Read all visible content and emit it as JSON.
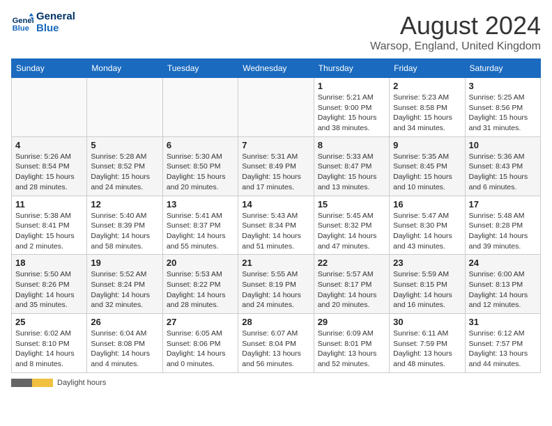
{
  "header": {
    "logo_line1": "General",
    "logo_line2": "Blue",
    "month_year": "August 2024",
    "location": "Warsop, England, United Kingdom"
  },
  "days_of_week": [
    "Sunday",
    "Monday",
    "Tuesday",
    "Wednesday",
    "Thursday",
    "Friday",
    "Saturday"
  ],
  "weeks": [
    [
      {
        "day": "",
        "info": ""
      },
      {
        "day": "",
        "info": ""
      },
      {
        "day": "",
        "info": ""
      },
      {
        "day": "",
        "info": ""
      },
      {
        "day": "1",
        "info": "Sunrise: 5:21 AM\nSunset: 9:00 PM\nDaylight: 15 hours\nand 38 minutes."
      },
      {
        "day": "2",
        "info": "Sunrise: 5:23 AM\nSunset: 8:58 PM\nDaylight: 15 hours\nand 34 minutes."
      },
      {
        "day": "3",
        "info": "Sunrise: 5:25 AM\nSunset: 8:56 PM\nDaylight: 15 hours\nand 31 minutes."
      }
    ],
    [
      {
        "day": "4",
        "info": "Sunrise: 5:26 AM\nSunset: 8:54 PM\nDaylight: 15 hours\nand 28 minutes."
      },
      {
        "day": "5",
        "info": "Sunrise: 5:28 AM\nSunset: 8:52 PM\nDaylight: 15 hours\nand 24 minutes."
      },
      {
        "day": "6",
        "info": "Sunrise: 5:30 AM\nSunset: 8:50 PM\nDaylight: 15 hours\nand 20 minutes."
      },
      {
        "day": "7",
        "info": "Sunrise: 5:31 AM\nSunset: 8:49 PM\nDaylight: 15 hours\nand 17 minutes."
      },
      {
        "day": "8",
        "info": "Sunrise: 5:33 AM\nSunset: 8:47 PM\nDaylight: 15 hours\nand 13 minutes."
      },
      {
        "day": "9",
        "info": "Sunrise: 5:35 AM\nSunset: 8:45 PM\nDaylight: 15 hours\nand 10 minutes."
      },
      {
        "day": "10",
        "info": "Sunrise: 5:36 AM\nSunset: 8:43 PM\nDaylight: 15 hours\nand 6 minutes."
      }
    ],
    [
      {
        "day": "11",
        "info": "Sunrise: 5:38 AM\nSunset: 8:41 PM\nDaylight: 15 hours\nand 2 minutes."
      },
      {
        "day": "12",
        "info": "Sunrise: 5:40 AM\nSunset: 8:39 PM\nDaylight: 14 hours\nand 58 minutes."
      },
      {
        "day": "13",
        "info": "Sunrise: 5:41 AM\nSunset: 8:37 PM\nDaylight: 14 hours\nand 55 minutes."
      },
      {
        "day": "14",
        "info": "Sunrise: 5:43 AM\nSunset: 8:34 PM\nDaylight: 14 hours\nand 51 minutes."
      },
      {
        "day": "15",
        "info": "Sunrise: 5:45 AM\nSunset: 8:32 PM\nDaylight: 14 hours\nand 47 minutes."
      },
      {
        "day": "16",
        "info": "Sunrise: 5:47 AM\nSunset: 8:30 PM\nDaylight: 14 hours\nand 43 minutes."
      },
      {
        "day": "17",
        "info": "Sunrise: 5:48 AM\nSunset: 8:28 PM\nDaylight: 14 hours\nand 39 minutes."
      }
    ],
    [
      {
        "day": "18",
        "info": "Sunrise: 5:50 AM\nSunset: 8:26 PM\nDaylight: 14 hours\nand 35 minutes."
      },
      {
        "day": "19",
        "info": "Sunrise: 5:52 AM\nSunset: 8:24 PM\nDaylight: 14 hours\nand 32 minutes."
      },
      {
        "day": "20",
        "info": "Sunrise: 5:53 AM\nSunset: 8:22 PM\nDaylight: 14 hours\nand 28 minutes."
      },
      {
        "day": "21",
        "info": "Sunrise: 5:55 AM\nSunset: 8:19 PM\nDaylight: 14 hours\nand 24 minutes."
      },
      {
        "day": "22",
        "info": "Sunrise: 5:57 AM\nSunset: 8:17 PM\nDaylight: 14 hours\nand 20 minutes."
      },
      {
        "day": "23",
        "info": "Sunrise: 5:59 AM\nSunset: 8:15 PM\nDaylight: 14 hours\nand 16 minutes."
      },
      {
        "day": "24",
        "info": "Sunrise: 6:00 AM\nSunset: 8:13 PM\nDaylight: 14 hours\nand 12 minutes."
      }
    ],
    [
      {
        "day": "25",
        "info": "Sunrise: 6:02 AM\nSunset: 8:10 PM\nDaylight: 14 hours\nand 8 minutes."
      },
      {
        "day": "26",
        "info": "Sunrise: 6:04 AM\nSunset: 8:08 PM\nDaylight: 14 hours\nand 4 minutes."
      },
      {
        "day": "27",
        "info": "Sunrise: 6:05 AM\nSunset: 8:06 PM\nDaylight: 14 hours\nand 0 minutes."
      },
      {
        "day": "28",
        "info": "Sunrise: 6:07 AM\nSunset: 8:04 PM\nDaylight: 13 hours\nand 56 minutes."
      },
      {
        "day": "29",
        "info": "Sunrise: 6:09 AM\nSunset: 8:01 PM\nDaylight: 13 hours\nand 52 minutes."
      },
      {
        "day": "30",
        "info": "Sunrise: 6:11 AM\nSunset: 7:59 PM\nDaylight: 13 hours\nand 48 minutes."
      },
      {
        "day": "31",
        "info": "Sunrise: 6:12 AM\nSunset: 7:57 PM\nDaylight: 13 hours\nand 44 minutes."
      }
    ]
  ],
  "legend": {
    "daylight_label": "Daylight hours"
  }
}
